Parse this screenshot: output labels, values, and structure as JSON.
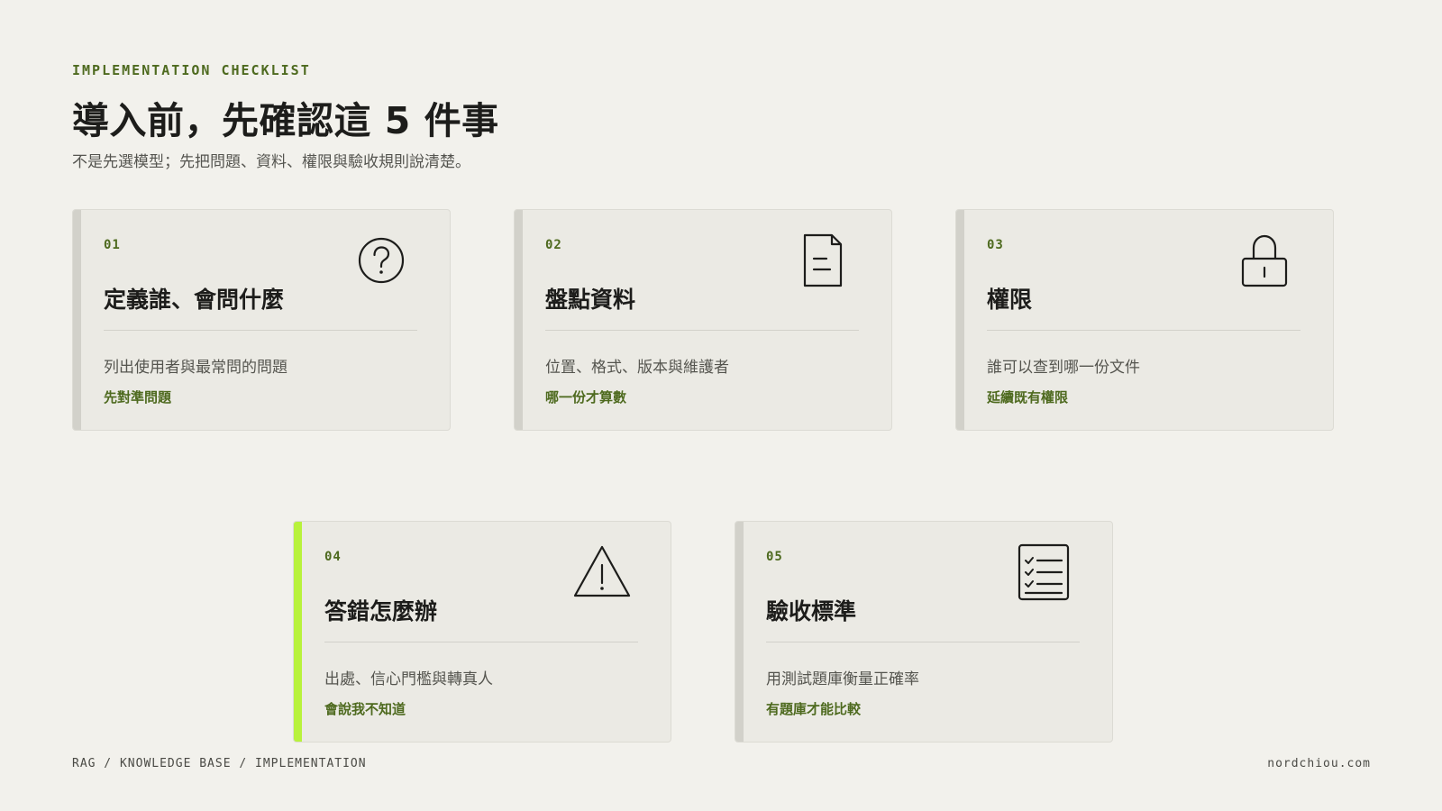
{
  "header": {
    "eyebrow": "IMPLEMENTATION CHECKLIST",
    "title": "導入前，先確認這 5 件事",
    "subtitle": "不是先選模型；先把問題、資料、權限與驗收規則說清楚。"
  },
  "cards": [
    {
      "number": "01",
      "title": "定義誰、會問什麼",
      "description": "列出使用者與最常問的問題",
      "note": "先對準問題",
      "icon": "question-circle-icon"
    },
    {
      "number": "02",
      "title": "盤點資料",
      "description": "位置、格式、版本與維護者",
      "note": "哪一份才算數",
      "icon": "document-icon"
    },
    {
      "number": "03",
      "title": "權限",
      "description": "誰可以查到哪一份文件",
      "note": "延續既有權限",
      "icon": "lock-icon"
    },
    {
      "number": "04",
      "title": "答錯怎麼辦",
      "description": "出處、信心門檻與轉真人",
      "note": "會說我不知道",
      "icon": "warning-triangle-icon"
    },
    {
      "number": "05",
      "title": "驗收標準",
      "description": "用測試題庫衡量正確率",
      "note": "有題庫才能比較",
      "icon": "checklist-icon"
    }
  ],
  "footer": {
    "breadcrumb": "RAG / KNOWLEDGE BASE / IMPLEMENTATION",
    "site": "nordchiou.com"
  },
  "colors": {
    "background": "#f2f1ec",
    "card": "#ebeae4",
    "accent": "#b8f23c",
    "label_green": "#4e6a1f",
    "bar_neutral": "#d2d1ca"
  }
}
